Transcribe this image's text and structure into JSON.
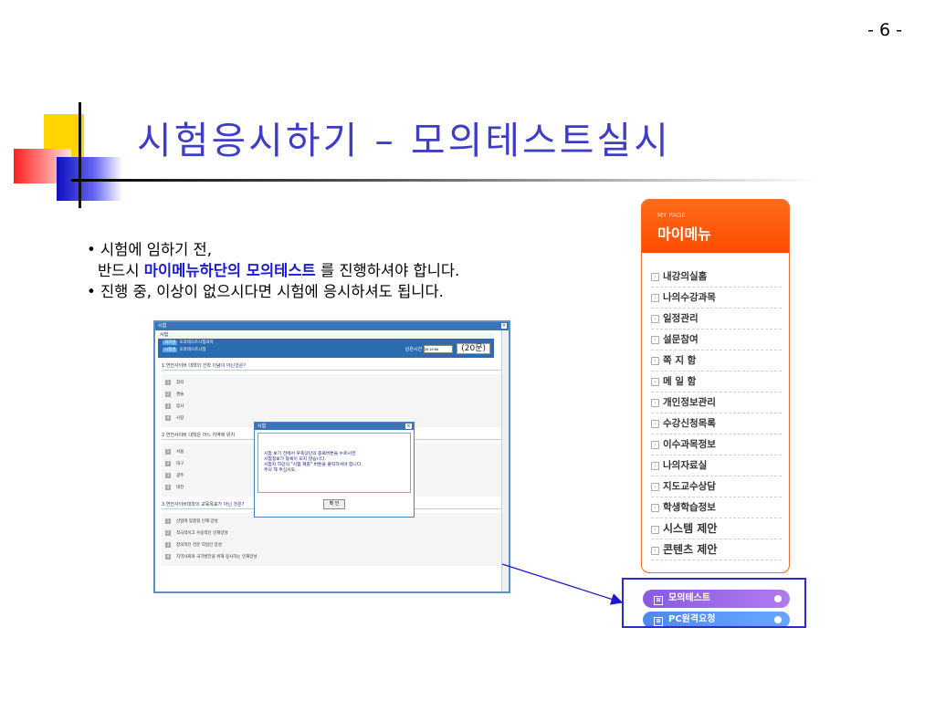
{
  "page_number": "- 6 -",
  "slide_title": "시험응시하기 – 모의테스트실시",
  "bullets": {
    "b1_line1": "• 시험에 임하기 전,",
    "b1_line2_pre": "반드시 ",
    "b1_line2_highlight": "마이메뉴하단의 모의테스트",
    "b1_line2_post": " 를 진행하셔야 합니다.",
    "b2": "• 진행 중, 이상이 없으시다면 시험에 응시하셔도 됩니다."
  },
  "exam_window": {
    "title": "시험",
    "close": "×",
    "header_title": "시험",
    "course_tag": "과목명",
    "course_name": "모의테스트시험과목",
    "exam_tag": "시험명",
    "exam_name": "모의테스트시험",
    "timer_label": "남은시간",
    "timer_value": "00:19:56",
    "question_count": "(20문)",
    "questions": [
      {
        "title": "1.연전사이버 대학의 건학 이념이 아닌것은?",
        "options": [
          "참의",
          "겸술",
          "봉사",
          "사랑"
        ]
      },
      {
        "title": "2.연전사이버 대학은 어느 지역에 위치",
        "options": [
          "서울",
          "대구",
          "광주",
          "대전"
        ]
      },
      {
        "title": "3.연전사이버대학의 교육목표가 아닌 것은?",
        "options": [
          "산업에 맞춤형 인재 양성",
          "적극적이고 수용적인 인재양성",
          "창의적인 전문 직업인 양성",
          "지역사회와 국가발전을 위해 봉사하는 인재양성"
        ]
      }
    ]
  },
  "dialog": {
    "title": "시험",
    "close": "×",
    "line1": "시험 보기 전에서 우측상단의 종료버튼을 누르시면",
    "line2": "시험정보가 등록이 되지 않습니다.",
    "line3": "시험지 하단의 \"시험 제출\" 버튼을 클릭하셔야 합니다.",
    "line4": "주의 해 주십시오.",
    "ok": "확 인"
  },
  "sidebar": {
    "subtitle": "MY PAGE",
    "title": "마이메뉴",
    "items": [
      "내강의실홈",
      "나의수강과목",
      "일정관리",
      "설문참여",
      "쪽 지 함",
      "메 일 함",
      "개인정보관리",
      "수강신청목록",
      "이수과목정보",
      "나의자료실",
      "지도교수상담",
      "학생학습정보",
      "시스템 제안",
      "콘텐츠 제안"
    ],
    "mock_test": "모의테스트",
    "pc_remote": "PC원격요청"
  },
  "colors": {
    "title": "#3d3dc6",
    "highlight": "#1a1ad0",
    "sidebar_orange": "#ff5a10",
    "mock_purple": "#9a66e8",
    "remote_blue": "#5294f5"
  }
}
